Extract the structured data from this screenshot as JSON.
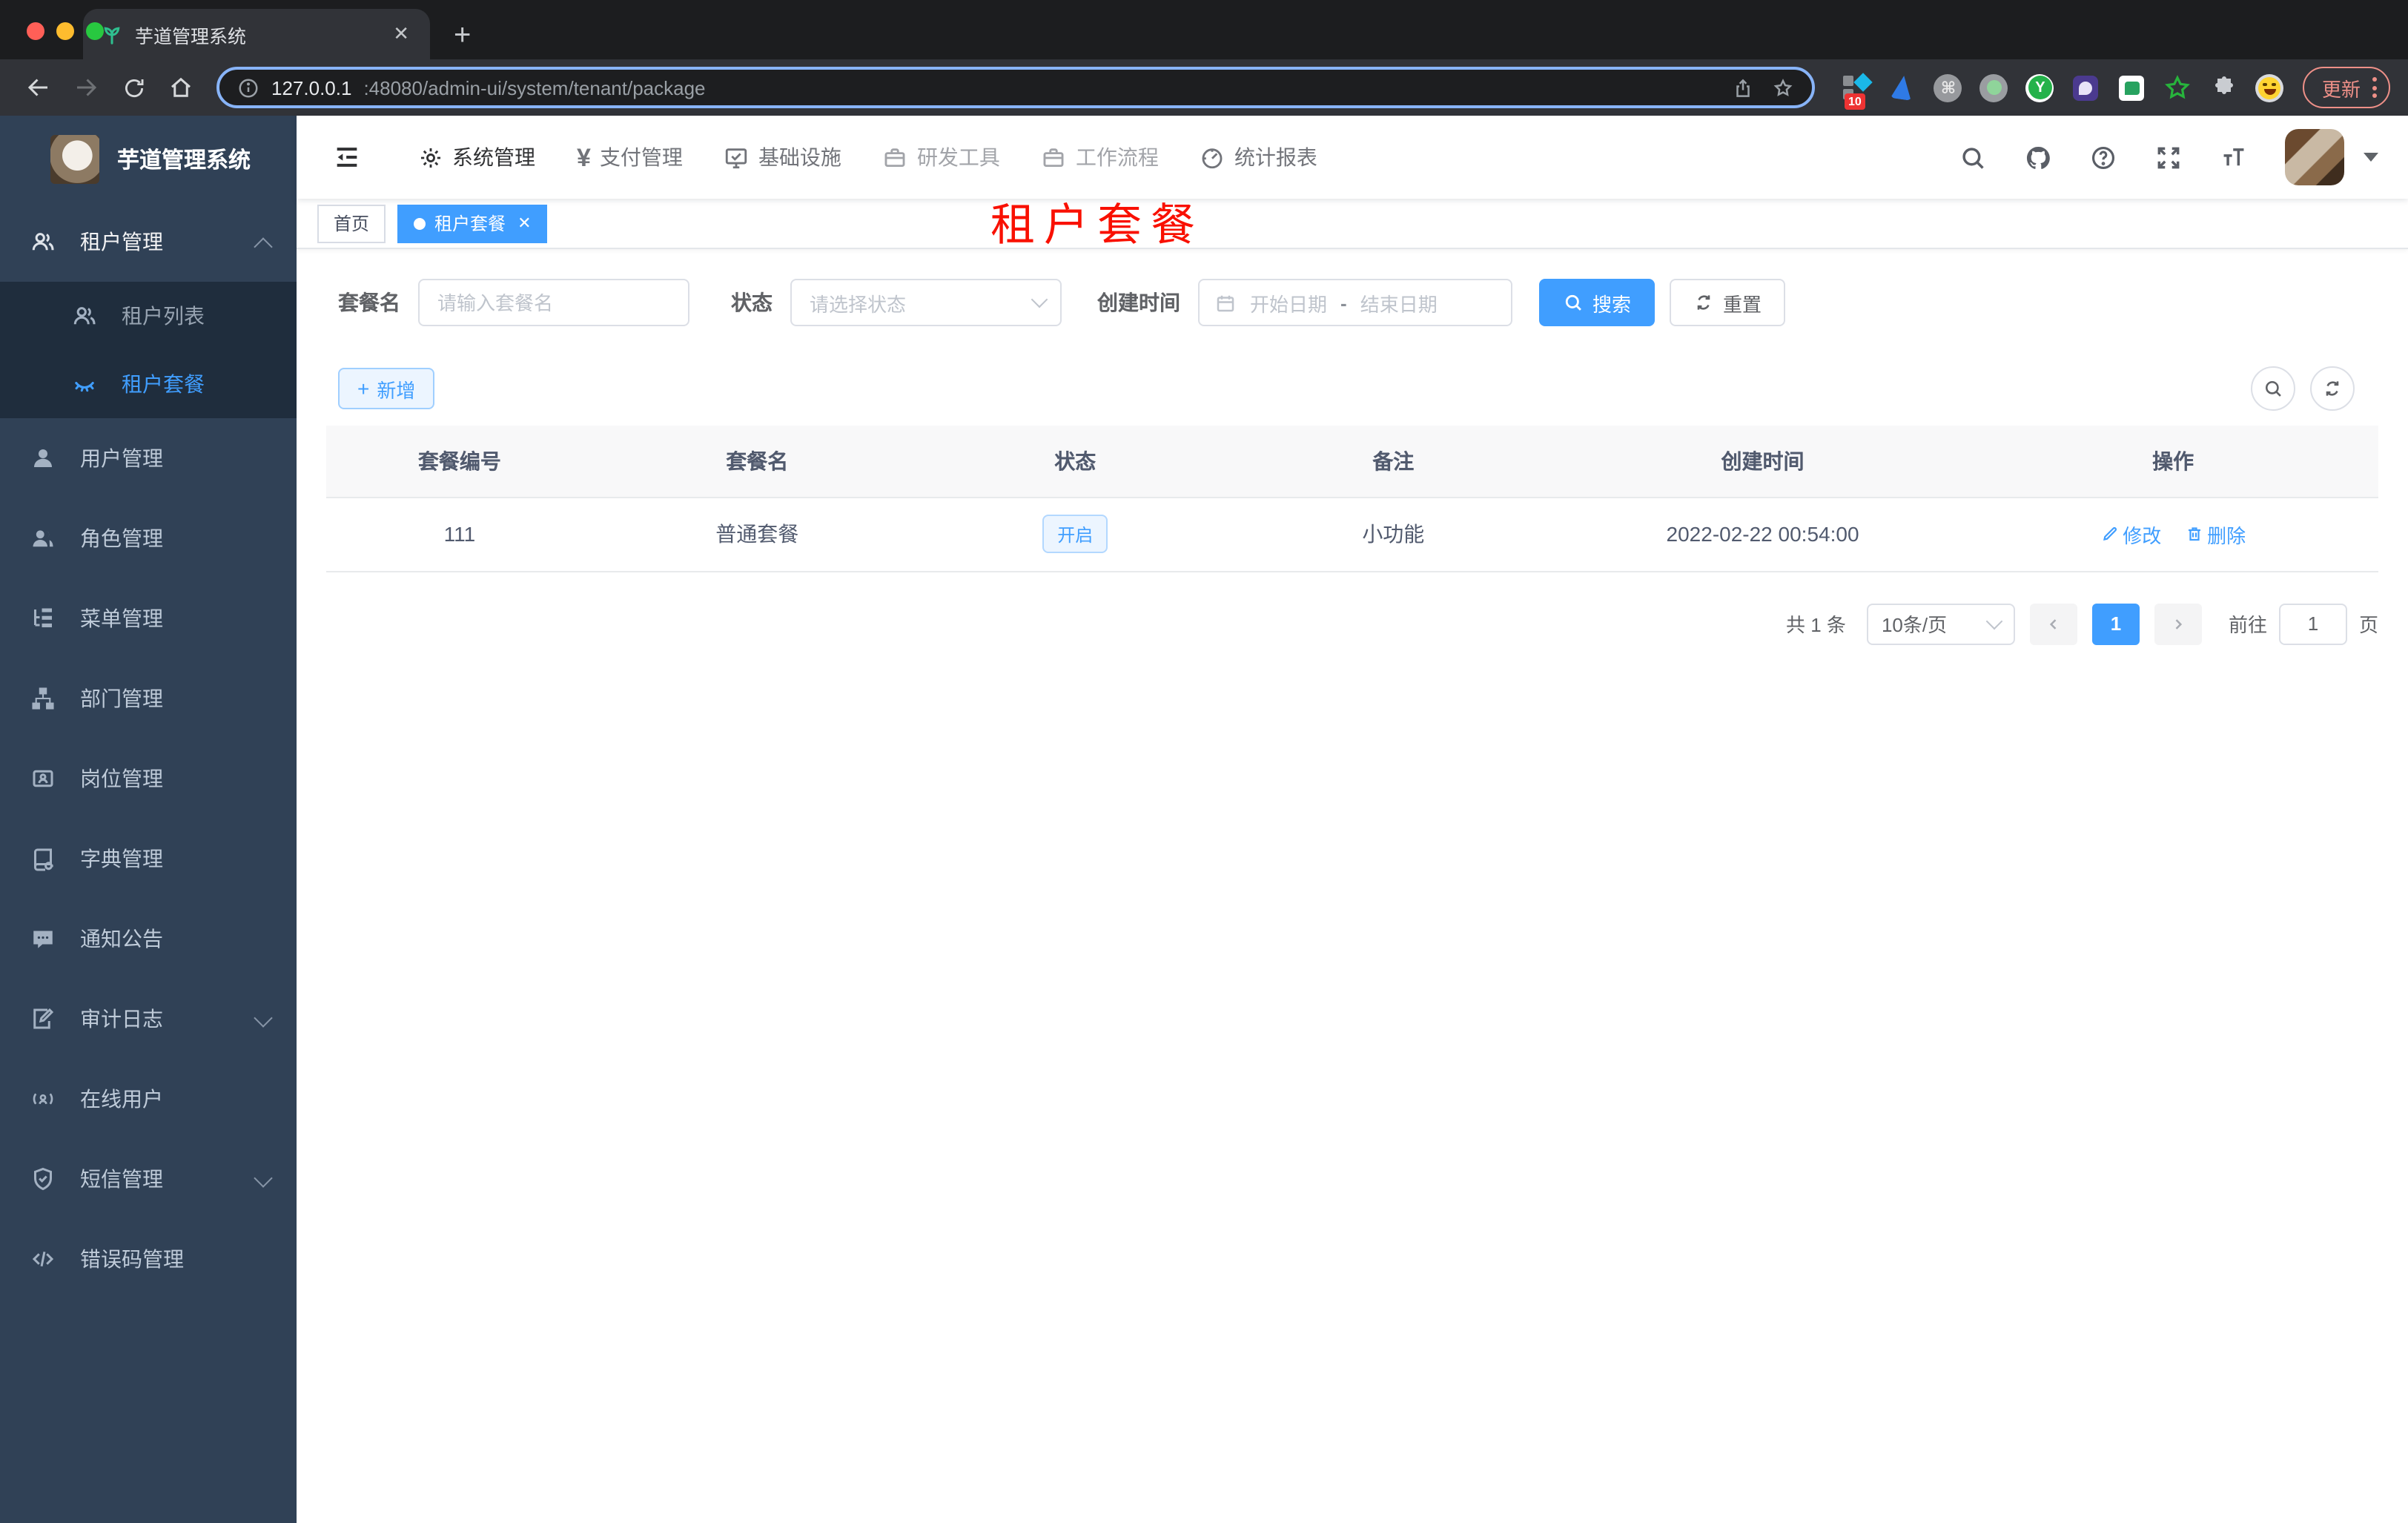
{
  "browser": {
    "tab": {
      "title": "芋道管理系统"
    },
    "url": {
      "host": "127.0.0.1",
      "path": ":48080/admin-ui/system/tenant/package"
    },
    "extensions": {
      "badge_count": "10"
    },
    "update_label": "更新"
  },
  "app": {
    "logo_title": "芋道管理系统",
    "nav": [
      {
        "label": "系统管理",
        "icon": "gear-icon"
      },
      {
        "label": "支付管理",
        "icon": "yen-icon"
      },
      {
        "label": "基础设施",
        "icon": "monitor-icon"
      },
      {
        "label": "研发工具",
        "icon": "briefcase-icon"
      },
      {
        "label": "工作流程",
        "icon": "briefcase-icon"
      },
      {
        "label": "统计报表",
        "icon": "gauge-icon"
      }
    ],
    "sidebar": [
      {
        "label": "租户管理",
        "icon": "peoples-icon"
      },
      {
        "label": "租户列表",
        "icon": "peoples-icon"
      },
      {
        "label": "租户套餐",
        "icon": "eye-closed-icon"
      },
      {
        "label": "用户管理",
        "icon": "user-icon"
      },
      {
        "label": "角色管理",
        "icon": "peoples-icon"
      },
      {
        "label": "菜单管理",
        "icon": "tree-table-icon"
      },
      {
        "label": "部门管理",
        "icon": "org-tree-icon"
      },
      {
        "label": "岗位管理",
        "icon": "post-icon"
      },
      {
        "label": "字典管理",
        "icon": "dict-icon"
      },
      {
        "label": "通知公告",
        "icon": "message-icon"
      },
      {
        "label": "审计日志",
        "icon": "log-icon"
      },
      {
        "label": "在线用户",
        "icon": "online-icon"
      },
      {
        "label": "短信管理",
        "icon": "shield-check-icon"
      },
      {
        "label": "错误码管理",
        "icon": "code-icon"
      }
    ],
    "tags": {
      "home": "首页",
      "current": "租户套餐"
    },
    "annotation": "租户套餐",
    "filters": {
      "name_label": "套餐名",
      "name_placeholder": "请输入套餐名",
      "status_label": "状态",
      "status_placeholder": "请选择状态",
      "date_label": "创建时间",
      "date_start": "开始日期",
      "date_sep": "-",
      "date_end": "结束日期",
      "search_label": "搜索",
      "reset_label": "重置"
    },
    "toolbar": {
      "add_label": "新增"
    },
    "table": {
      "columns": [
        "套餐编号",
        "套餐名",
        "状态",
        "备注",
        "创建时间",
        "操作"
      ],
      "rows": [
        {
          "id": "111",
          "name": "普通套餐",
          "status": "开启",
          "remark": "小功能",
          "created": "2022-02-22 00:54:00"
        }
      ]
    },
    "actions": {
      "edit": "修改",
      "delete": "删除"
    },
    "pagination": {
      "total": "共 1 条",
      "page_size": "10条/页",
      "current": "1",
      "goto_label": "前往",
      "goto_value": "1",
      "unit": "页"
    }
  },
  "colors": {
    "accent": "#409eff",
    "sidebar_bg": "#304156",
    "submenu_bg": "#1f2d3d",
    "annotation": "#f91000"
  }
}
